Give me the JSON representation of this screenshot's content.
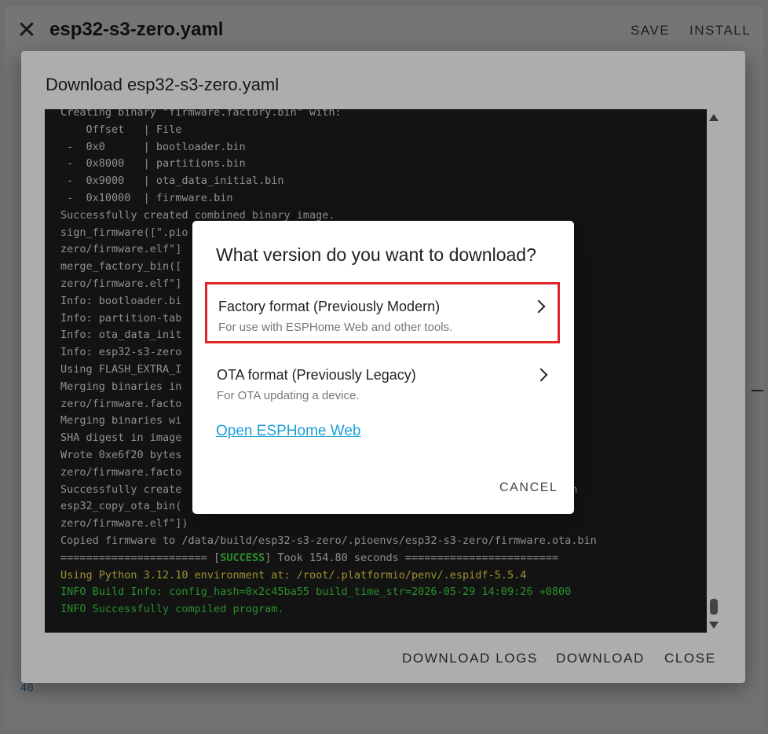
{
  "editor": {
    "title": "esp32-s3-zero.yaml",
    "save_label": "SAVE",
    "install_label": "INSTALL",
    "line_number": "40"
  },
  "download_dialog": {
    "title": "Download esp32-s3-zero.yaml",
    "buttons": {
      "download_logs": "DOWNLOAD LOGS",
      "download": "DOWNLOAD",
      "close": "CLOSE"
    },
    "log_lines": [
      {
        "text": "Creating binary \"firmware.factory.bin\" with:",
        "color": "normal"
      },
      {
        "text": "    Offset   | File",
        "color": "normal"
      },
      {
        "text": " -  0x0      | bootloader.bin",
        "color": "normal"
      },
      {
        "text": " -  0x8000   | partitions.bin",
        "color": "normal"
      },
      {
        "text": " -  0x9000   | ota_data_initial.bin",
        "color": "normal"
      },
      {
        "text": " -  0x10000  | firmware.bin",
        "color": "normal"
      },
      {
        "text": "Successfully created combined binary image.",
        "color": "normal"
      },
      {
        "text": "sign_firmware([\".pio                                                -",
        "color": "normal"
      },
      {
        "text": "zero/firmware.elf\"]",
        "color": "normal"
      },
      {
        "text": "merge_factory_bin([                                               32-s3-",
        "color": "normal"
      },
      {
        "text": "zero/firmware.elf\"]",
        "color": "normal"
      },
      {
        "text": "Info: bootloader.bi",
        "color": "normal"
      },
      {
        "text": "Info: partition-tab",
        "color": "normal"
      },
      {
        "text": "Info: ota_data_init",
        "color": "normal"
      },
      {
        "text": "Info: esp32-s3-zero",
        "color": "normal"
      },
      {
        "text": "Using FLASH_EXTRA_I",
        "color": "normal"
      },
      {
        "text": "Merging binaries in",
        "color": "normal"
      },
      {
        "text": "zero/firmware.facto",
        "color": "normal"
      },
      {
        "text": "Merging binaries wi",
        "color": "normal"
      },
      {
        "text": "SHA digest in image",
        "color": "normal"
      },
      {
        "text": "Wrote 0xe6f20 bytes",
        "color": "normal"
      },
      {
        "text": "zero/firmware.facto",
        "color": "normal"
      },
      {
        "text": "Successfully create                                              ware.factory.bin",
        "color": "normal"
      },
      {
        "text": "esp32_copy_ota_bin(                                              32-s3-",
        "color": "normal"
      },
      {
        "text": "zero/firmware.elf\"])",
        "color": "normal"
      },
      {
        "text": "Copied firmware to /data/build/esp32-s3-zero/.pioenvs/esp32-s3-zero/firmware.ota.bin",
        "color": "normal"
      },
      {
        "text": "======================= [SUCCESS] Took 154.80 seconds ========================",
        "color": "success"
      },
      {
        "text": "Using Python 3.12.10 environment at: /root/.platformio/penv/.espidf-5.5.4",
        "color": "yellow"
      },
      {
        "text": "INFO Build Info: config_hash=0x2c45ba55 build_time_str=2026-05-29 14:09:26 +0800",
        "color": "green"
      },
      {
        "text": "INFO Successfully compiled program.",
        "color": "green"
      }
    ]
  },
  "version_dialog": {
    "title": "What version do you want to download?",
    "options": [
      {
        "title": "Factory format (Previously Modern)",
        "description": "For use with ESPHome Web and other tools."
      },
      {
        "title": "OTA format (Previously Legacy)",
        "description": "For OTA updating a device."
      }
    ],
    "link_label": "Open ESPHome Web",
    "cancel_label": "CANCEL"
  },
  "colors": {
    "link": "#1aa0d8",
    "highlight_border": "#e0242a",
    "log_background": "#1c1c1c",
    "log_success": "#3fd13f",
    "log_warning": "#e6d84a"
  }
}
